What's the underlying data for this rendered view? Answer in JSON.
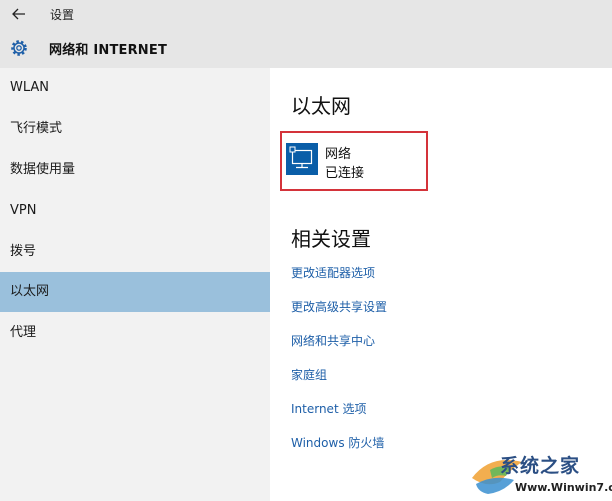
{
  "window": {
    "title": "设置"
  },
  "header": {
    "title": "网络和 INTERNET"
  },
  "sidebar": {
    "items": [
      {
        "label": "WLAN"
      },
      {
        "label": "飞行模式"
      },
      {
        "label": "数据使用量"
      },
      {
        "label": "VPN"
      },
      {
        "label": "拨号"
      },
      {
        "label": "以太网",
        "selected": true
      },
      {
        "label": "代理"
      }
    ]
  },
  "main": {
    "section_title": "以太网",
    "network": {
      "name": "网络",
      "status": "已连接"
    },
    "related_title": "相关设置",
    "links": [
      {
        "label": "更改适配器选项"
      },
      {
        "label": "更改高级共享设置"
      },
      {
        "label": "网络和共享中心"
      },
      {
        "label": "家庭组"
      },
      {
        "label": "Internet 选项"
      },
      {
        "label": "Windows 防火墙"
      }
    ]
  },
  "watermark": {
    "text": "系统之家",
    "url": "Www.Winwin7.com"
  },
  "colors": {
    "accent": "#0a5ea8",
    "selected": "#9ac0dc",
    "link": "#1e5fa8",
    "highlight_border": "#d4333a"
  },
  "icons": {
    "back": "back-arrow-icon",
    "settings": "gear-icon",
    "network": "ethernet-icon"
  }
}
